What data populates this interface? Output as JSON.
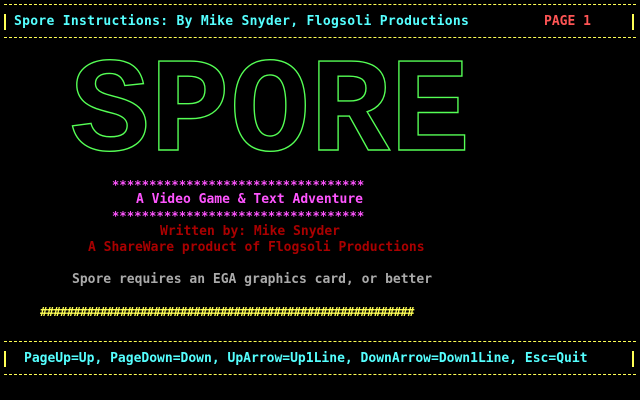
{
  "header": {
    "title": "Spore Instructions: By Mike Snyder, Flogsoli Productions",
    "page_label": "PAGE 1"
  },
  "logo": {
    "text": "SPORE",
    "color": "#55ff55"
  },
  "intro": {
    "stars_top": "**********************************",
    "subtitle": "A Video Game & Text Adventure",
    "stars_bottom": "**********************************",
    "author": "Written by: Mike Snyder",
    "shareware": "A ShareWare product of Flogsoli Productions",
    "requirement": "Spore requires an EGA graphics card, or better",
    "progress_bar": "########################################################"
  },
  "footer": {
    "keys": "PageUp=Up, PageDown=Down, UpArrow=Up1Line, DownArrow=Down1Line, Esc=Quit"
  },
  "colors": {
    "background": "#000000",
    "border": "#ffff55",
    "title": "#55ffff",
    "page_label": "#ff5555",
    "logo": "#55ff55",
    "stars": "#ff55ff",
    "author": "#aa0000",
    "requirement": "#aaaaaa"
  }
}
